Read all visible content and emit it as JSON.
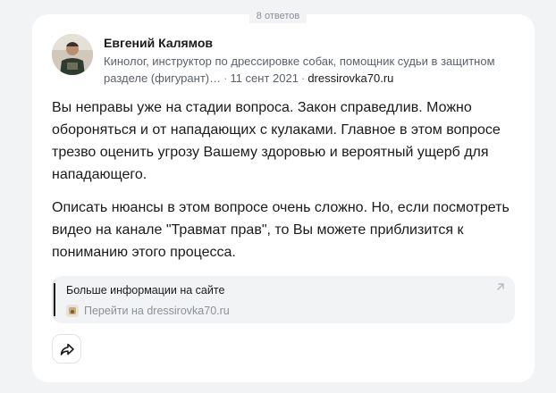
{
  "answers_count": "8 ответов",
  "author": {
    "name": "Евгений Калямов",
    "bio": "Кинолог, инструктор по дрессировке собак, помощник судьи в защитном разделе (фигурант)…",
    "date": "11 сент 2021",
    "site": "dressirovka70.ru"
  },
  "answer": {
    "paragraph_1": "Вы неправы уже на стадии вопроса. Закон справедлив. Можно обороняться и от нападающих с кулаками. Главное в этом вопросе трезво оценить угрозу Вашему здоровью и вероятный ущерб для нападающего.",
    "paragraph_2": "Описать нюансы в этом вопросе очень сложно. Но, если посмотреть видео на канале \"Травмат прав\", то Вы можете приблизится к пониманию этого процесса."
  },
  "link_card": {
    "title": "Больше информации на сайте",
    "url_text": "Перейти на dressirovka70.ru"
  },
  "actions": {
    "share_icon": "share-icon"
  },
  "colors": {
    "page_bg": "#f2f3f5",
    "card_bg": "#ffffff",
    "text": "#1a1a1a",
    "muted": "#8a8f99"
  }
}
